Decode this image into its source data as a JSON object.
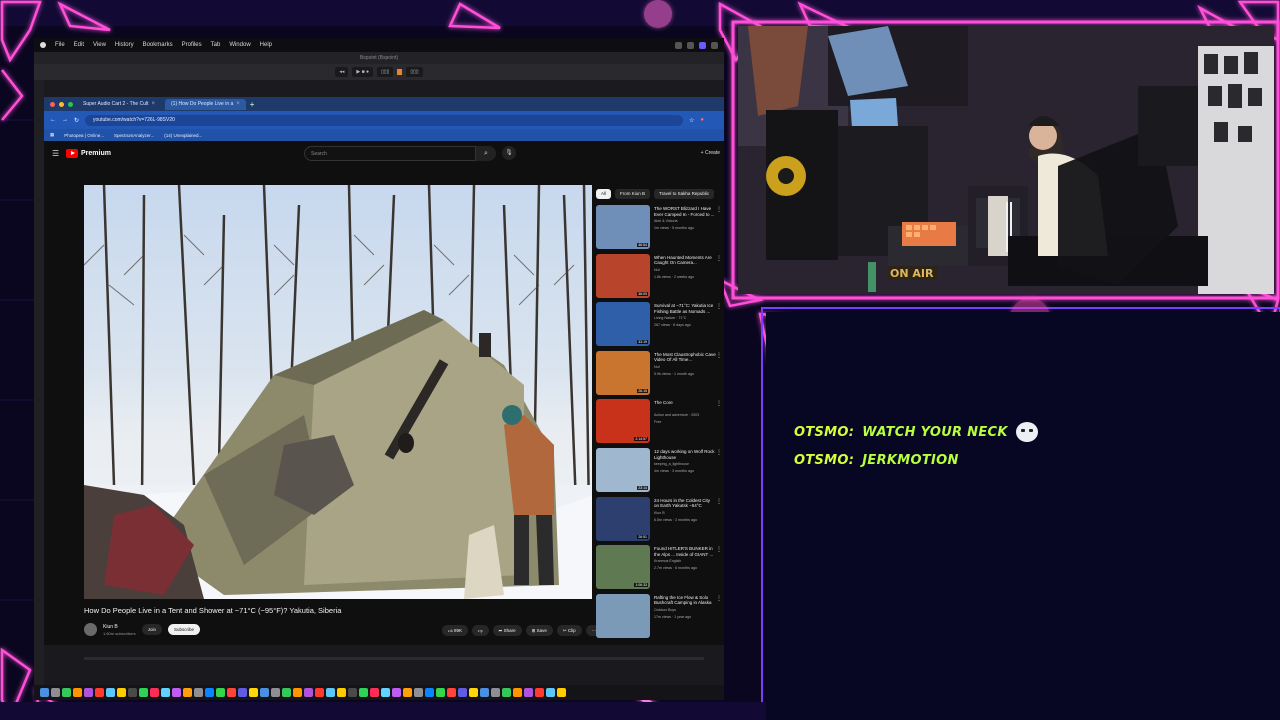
{
  "mac_menubar": {
    "items": [
      "File",
      "Edit",
      "View",
      "History",
      "Bookmarks",
      "Profiles",
      "Tab",
      "Window",
      "Help"
    ]
  },
  "daw": {
    "window_title": "Bspoint (Bspoint)"
  },
  "browser": {
    "tabs": [
      {
        "label": "Super Audio Cart 2 - The Cult"
      },
      {
        "label": "(1) How Do People Live in a"
      }
    ],
    "url": "youtube.com/watch?v=726L-98SV20",
    "bookmarks": [
      "Photopea | Online...",
      "SpectrumAnalyzer...",
      "(14) Unexplained..."
    ]
  },
  "youtube": {
    "logo_text": "Premium",
    "search_placeholder": "Search",
    "create_label": "+ Create",
    "video_title": "How Do People Live in a Tent and Shower at −71°C (−95°F)? Yakutia, Siberia",
    "channel_name": "Kiun B",
    "subscribers": "1.60m subscribers",
    "join_label": "Join",
    "subscribe_label": "Subscribe",
    "actions": [
      "89K",
      "",
      "Share",
      "Save",
      "Clip",
      "···"
    ],
    "chips": [
      {
        "label": "All",
        "selected": true
      },
      {
        "label": "From Kiun B",
        "selected": false
      },
      {
        "label": "Travel to Sakha Republic",
        "selected": false
      }
    ],
    "recommendations": [
      {
        "title": "The WORST Blizzard I Have Ever Camped In - Forced to ...",
        "channel": "Abel & Victoria",
        "views": "1m views · 5 months ago",
        "duration": "46:54",
        "thumb": "#6f8fb8"
      },
      {
        "title": "When Haunted Moments Are Caught On Camera...",
        "channel": "Nuf",
        "views": "1.8k views · 2 weeks ago",
        "duration": "36:09",
        "thumb": "#b8442b"
      },
      {
        "title": "Survival at −71°C: Yakutia Ice Fishing Battle as Nomads ...",
        "channel": "Living Nature · 71°C",
        "views": "267 views · 8 days ago",
        "duration": "33:19",
        "thumb": "#2f5fa8"
      },
      {
        "title": "The Most Claustrophobic Cave Video Of All Time...",
        "channel": "Nuf",
        "views": "5.9k views · 1 month ago",
        "duration": "26:15",
        "thumb": "#c9742f"
      },
      {
        "title": "The Core",
        "channel": "Action and adventure · 2003",
        "views": "Free",
        "duration": "2:14:57",
        "thumb": "#c8321b"
      },
      {
        "title": "12 days working on Wolf Rock Lighthouse",
        "channel": "keeping_a_lighthouse",
        "views": "4m views · 3 months ago",
        "duration": "23:14",
        "thumb": "#9fb7cf"
      },
      {
        "title": "24 Hours in the Coldest City on Earth Yakutsk −64°C (−83°F)",
        "channel": "Kiun B",
        "views": "6.5m views · 2 months ago",
        "duration": "26:51",
        "thumb": "#2c3f6f"
      },
      {
        "title": "Found HITLER'S BUNKER in the Alps ... Inside of GIANT ...",
        "channel": "Kranmus English",
        "views": "2.7m views · 6 months ago",
        "duration": "1:06:33",
        "thumb": "#5f7a52"
      },
      {
        "title": "Rafting the Ice Flow & Solo Bushcraft Camping in Alaska",
        "channel": "Outdoor Boys",
        "views": "17m views · 1 year ago",
        "duration": "",
        "thumb": "#7a9ab8"
      }
    ]
  },
  "webcam": {
    "sign_text": "ON AIR"
  },
  "chat": {
    "messages": [
      {
        "user": "OTSMO:",
        "text": "WATCH YOUR NECK",
        "emote": "ghost-emote"
      },
      {
        "user": "OTSMO:",
        "text": "JERKMOTION",
        "emote": ""
      }
    ]
  },
  "colors": {
    "frame_accent": "#ff3fd8",
    "frame_secondary": "#b03bff",
    "chat_text": "#b7ff3f",
    "chat_background": "#070724"
  }
}
